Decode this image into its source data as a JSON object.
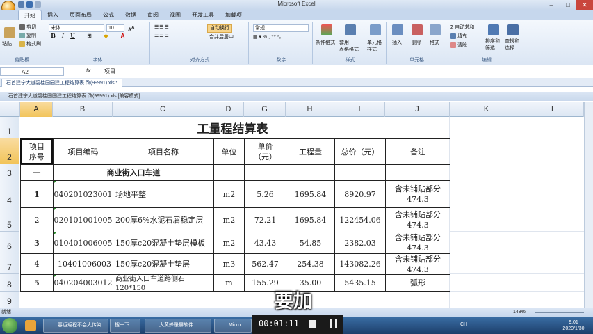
{
  "app": {
    "title": "Microsoft Excel"
  },
  "tabs": [
    "开始",
    "插入",
    "页面布局",
    "公式",
    "数据",
    "审阅",
    "视图",
    "开发工具",
    "加载项"
  ],
  "ribbon": {
    "clipboard": {
      "paste": "粘贴",
      "cut": "剪切",
      "copy": "复制",
      "format_painter": "格式刷",
      "label": "剪贴板"
    },
    "font": {
      "name": "宋体",
      "size": "10",
      "label": "字体"
    },
    "alignment": {
      "wrap": "自动换行",
      "merge": "合并后居中",
      "label": "对齐方式"
    },
    "number": {
      "format": "常规",
      "label": "数字"
    },
    "styles": {
      "conditional": "条件格式",
      "table": "套用\n表格格式",
      "cell": "单元格\n样式",
      "label": "样式"
    },
    "cells": {
      "insert": "插入",
      "delete": "删除",
      "format": "格式",
      "label": "单元格"
    },
    "editing": {
      "autosum": "自动求和",
      "fill": "填充",
      "clear": "清除",
      "sort": "排序和\n筛选",
      "find": "查找和\n选择",
      "label": "编辑"
    }
  },
  "formula_bar": {
    "name_box": "A2",
    "fx": "fx",
    "value": "项目"
  },
  "workbook": {
    "tab": "石首建宁大道碧桂园园建工程结算表 改(99991).xls *",
    "window_title": "石首建宁大道碧桂园园建工程结算表 改(99991).xls  [兼容模式]"
  },
  "sheet": {
    "columns": [
      "A",
      "B",
      "C",
      "D",
      "G",
      "H",
      "I",
      "J",
      "K",
      "L"
    ],
    "rows": [
      "1",
      "2",
      "3",
      "4",
      "5",
      "6",
      "7",
      "8",
      "9"
    ],
    "title": "工量程结算表",
    "header": [
      "项目\n序号",
      "项目编码",
      "项目名称",
      "单位",
      "单价\n（元）",
      "工程量",
      "总价（元）",
      "备注"
    ],
    "section": {
      "no": "一",
      "name": "商业街入口车道"
    },
    "items": [
      {
        "no": "1",
        "code": "040201023001",
        "name": "场地平整",
        "unit": "m2",
        "price": "5.26",
        "qty": "1695.84",
        "total": "8920.97",
        "note": "含未铺贴部分\n474.3"
      },
      {
        "no": "2",
        "code": "020101001005",
        "name": "200厚6%水泥石屑稳定层",
        "unit": "m2",
        "price": "72.21",
        "qty": "1695.84",
        "total": "122454.06",
        "note": "含未铺贴部分\n474.3"
      },
      {
        "no": "3",
        "code": "010401006005",
        "name": "150厚c20混凝土垫层模板",
        "unit": "m2",
        "price": "43.43",
        "qty": "54.85",
        "total": "2382.03",
        "note": "含未铺贴部分\n474.3"
      },
      {
        "no": "4",
        "code": "10401006003",
        "name": "150厚c20混凝土垫层",
        "unit": "m3",
        "price": "562.47",
        "qty": "254.38",
        "total": "143082.26",
        "note": "含未铺贴部分\n474.3"
      },
      {
        "no": "5",
        "code": "040204003012",
        "name": "商业街入口车道路侧石\n120*150",
        "unit": "m",
        "price": "155.29",
        "qty": "35.00",
        "total": "5435.15",
        "note": "弧形"
      }
    ]
  },
  "status": {
    "ready": "就绪",
    "zoom": "148%"
  },
  "taskbar": {
    "items": [
      "春运返程不会大传染",
      "搜一下",
      "大黄蜂录屏软件",
      "Micro"
    ],
    "time": "9:01",
    "date": "2020/1/30",
    "lang": "CH"
  },
  "recorder": {
    "time": "00:01:11"
  },
  "subtitle": "要加"
}
